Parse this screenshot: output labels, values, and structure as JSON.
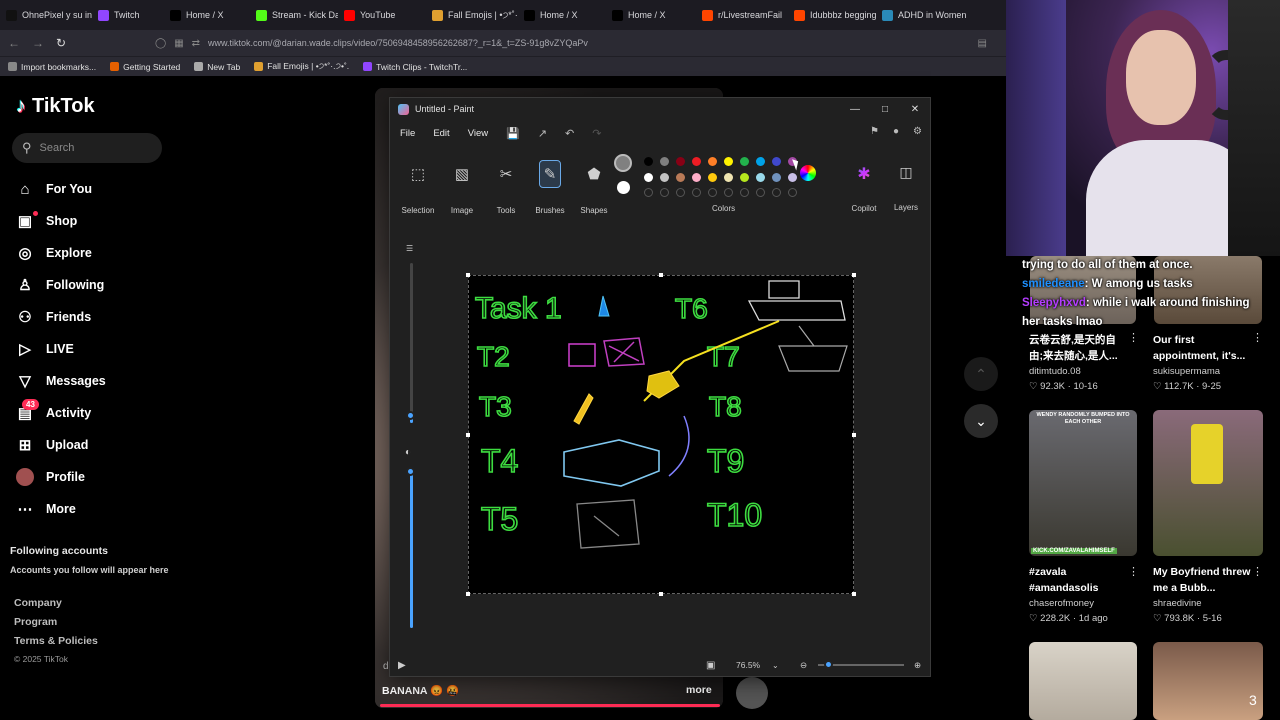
{
  "browser": {
    "tabs": [
      {
        "label": "OhnePixel y su in",
        "color": "#111"
      },
      {
        "label": "Twitch",
        "color": "#9146ff"
      },
      {
        "label": "Home / X",
        "color": "#000"
      },
      {
        "label": "Stream - Kick Dar",
        "color": "#53fc18"
      },
      {
        "label": "YouTube",
        "color": "#ff0000"
      },
      {
        "label": "Fall Emojis | •੭*˚·.",
        "color": "#e0a030"
      },
      {
        "label": "Home / X",
        "color": "#000"
      },
      {
        "label": "Home / X",
        "color": "#000"
      },
      {
        "label": "r/LivestreamFail",
        "color": "#ff4500"
      },
      {
        "label": "Idubbbz begging",
        "color": "#ff4500"
      },
      {
        "label": "ADHD in Women",
        "color": "#2a8ab8"
      }
    ],
    "url": "www.tiktok.com/@darian.wade.clips/video/7506948458956262687?_r=1&_t=ZS-91g8vZYQaPv",
    "bookmarks": [
      {
        "label": "Import bookmarks...",
        "color": "#888"
      },
      {
        "label": "Getting Started",
        "color": "#e66000"
      },
      {
        "label": "New Tab",
        "color": "#aaa"
      },
      {
        "label": "Fall Emojis | •੭*˚·.੭•˚.",
        "color": "#e0a030"
      },
      {
        "label": "Twitch Clips - TwitchTr...",
        "color": "#9146ff"
      }
    ]
  },
  "tiktok": {
    "logo": "TikTok",
    "search_placeholder": "Search",
    "nav": [
      {
        "label": "For You",
        "icon": "home-icon"
      },
      {
        "label": "Shop",
        "icon": "bag-icon"
      },
      {
        "label": "Explore",
        "icon": "compass-icon"
      },
      {
        "label": "Following",
        "icon": "user-icon"
      },
      {
        "label": "Friends",
        "icon": "friends-icon"
      },
      {
        "label": "LIVE",
        "icon": "live-icon"
      },
      {
        "label": "Messages",
        "icon": "send-icon"
      },
      {
        "label": "Activity",
        "icon": "inbox-icon",
        "badge": "43"
      },
      {
        "label": "Upload",
        "icon": "plus-icon"
      },
      {
        "label": "Profile",
        "icon": "avatar"
      },
      {
        "label": "More",
        "icon": "more-icon"
      }
    ],
    "following_heading": "Following accounts",
    "following_sub": "Accounts you follow will appear here",
    "footer": [
      "Company",
      "Program",
      "Terms & Policies"
    ],
    "copyright": "© 2025 TikTok",
    "video_caption": "BANANA 😡 🤬",
    "video_more": "more",
    "video_desc_letter": "d"
  },
  "paint": {
    "title": "Untitled - Paint",
    "menu": [
      "File",
      "Edit",
      "View"
    ],
    "tools": [
      {
        "label": "Selection",
        "icon": "selection-icon"
      },
      {
        "label": "Image",
        "icon": "image-icon"
      },
      {
        "label": "Tools",
        "icon": "tools-icon"
      },
      {
        "label": "Brushes",
        "icon": "brush-icon"
      },
      {
        "label": "Shapes",
        "icon": "shapes-icon"
      }
    ],
    "colors_label": "Colors",
    "copilot_label": "Copilot",
    "layers_label": "Layers",
    "palette_row1": [
      "#000000",
      "#7f7f7f",
      "#880015",
      "#ed1c24",
      "#ff7f27",
      "#fff200",
      "#22b14c",
      "#00a2e8",
      "#3f48cc",
      "#a349a4"
    ],
    "palette_row2": [
      "#ffffff",
      "#c3c3c3",
      "#b97a57",
      "#ffaec9",
      "#ffc90e",
      "#efe4b0",
      "#b5e61d",
      "#99d9ea",
      "#7092be",
      "#c8bfe7"
    ],
    "zoom": "76.5%",
    "canvas_labels": [
      "Task 1",
      "T2",
      "T3",
      "T4",
      "T5",
      "T6",
      "T7",
      "T8",
      "T9",
      "T10"
    ]
  },
  "stream": {
    "chat": [
      {
        "user": "",
        "text": "trying to do all of them at once.",
        "color": "#ffffff"
      },
      {
        "user": "smiledeane",
        "text": ": W among us tasks",
        "color": "#1e90ff"
      },
      {
        "user": "Sleepyhxvd",
        "text": ": while i walk around finishing her tasks lmao",
        "color": "#b43cff"
      }
    ]
  },
  "feed": [
    {
      "title": "云卷云舒,是天的自由;来去随心,是人...",
      "user": "ditimtudo.08",
      "views": "92.3K",
      "date": "10-16"
    },
    {
      "title": "Our first appointment, it's...",
      "user": "sukisupermama",
      "views": "112.7K",
      "date": "9-25"
    },
    {
      "title": "#zavala #amandasolis",
      "user": "chaserofmoney",
      "views": "228.2K",
      "date": "1d ago",
      "thumb_text": "WENDY RANDOMLY BUMPED INTO EACH OTHER",
      "thumb_tag": "KICK.COM/ZAVALAHIMSELF"
    },
    {
      "title": "My Boyfriend threw me a Bubb...",
      "user": "shraedivine",
      "views": "793.8K",
      "date": "5-16"
    }
  ]
}
